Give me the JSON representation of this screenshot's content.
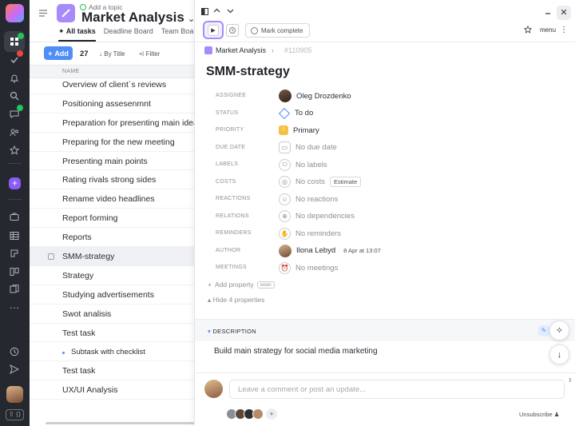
{
  "sidebar": {
    "icons": [
      "home-icon",
      "check-icon",
      "bell-icon",
      "search-icon",
      "chat-icon",
      "people-icon",
      "star-icon",
      "plus-icon",
      "briefcase-icon",
      "table-icon",
      "board-icon",
      "kanban-icon",
      "files-icon",
      "more-icon",
      "clock-icon",
      "send-icon"
    ],
    "shortcut_label": "⇧ ⟨⟩"
  },
  "project": {
    "topic_label": "Add a topic",
    "title": "Market Analysis",
    "tabs": [
      {
        "label": "All tasks",
        "active": true
      },
      {
        "label": "Deadline Board",
        "active": false
      },
      {
        "label": "Team Board",
        "active": false
      }
    ],
    "add_label": "Add",
    "count": "27",
    "sort_label": "By Title",
    "filter_label": "Filter",
    "column_header": "NAME"
  },
  "tasks": [
    {
      "title": "Overview of client`s reviews"
    },
    {
      "title": "Positioning assesenmnt"
    },
    {
      "title": "Preparation for presenting main ideas"
    },
    {
      "title": "Preparing for the new meeting"
    },
    {
      "title": "Presenting main points"
    },
    {
      "title": "Rating rivals strong sides"
    },
    {
      "title": "Rename video headlines"
    },
    {
      "title": "Report forming"
    },
    {
      "title": "Reports"
    },
    {
      "title": "SMM-strategy",
      "selected": true
    },
    {
      "title": "Strategy"
    },
    {
      "title": "Studying advertisements"
    },
    {
      "title": "Swot analisis"
    },
    {
      "title": "Test task"
    },
    {
      "title": "Subtask with checklist",
      "subtask": true
    },
    {
      "title": "Test task"
    },
    {
      "title": "UX/UI Analysis"
    }
  ],
  "detail": {
    "mark_complete": "Mark complete",
    "menu_label": "menu",
    "breadcrumb_project": "Market Analysis",
    "breadcrumb_id": "#110905",
    "task_title": "SMM-strategy",
    "properties": [
      {
        "key": "ASSIGNEE",
        "value": "Oleg Drozdenko",
        "icon": "avatar"
      },
      {
        "key": "STATUS",
        "value": "To do",
        "icon": "status-diamond-icon"
      },
      {
        "key": "PRIORITY",
        "value": "Primary",
        "icon": "priority-flag-icon"
      },
      {
        "key": "DUE DATE",
        "value": "No due date",
        "icon": "calendar-icon"
      },
      {
        "key": "LABELS",
        "value": "No labels",
        "icon": "tag-icon"
      },
      {
        "key": "COSTS",
        "value": "No costs",
        "icon": "coin-icon",
        "extra": "Estimate"
      },
      {
        "key": "REACTIONS",
        "value": "No reactions",
        "icon": "smile-icon"
      },
      {
        "key": "RELATIONS",
        "value": "No dependencies",
        "icon": "link-icon"
      },
      {
        "key": "REMINDERS",
        "value": "No reminders",
        "icon": "hand-icon"
      },
      {
        "key": "AUTHOR",
        "value": "Ilona Lebyd",
        "icon": "avatar",
        "extra": "8 Apr at 13:07"
      },
      {
        "key": "MEETINGS",
        "value": "No meetings",
        "icon": "alarm-icon"
      }
    ],
    "add_property": "Add property",
    "soon_badge": "soon",
    "hide_properties": "Hide 4 properties",
    "description_label": "DESCRIPTION",
    "description_text": "Build main strategy for social media marketing",
    "comment_placeholder": "Leave a comment or post an update...",
    "unsubscribe_label": "Unsubscribe"
  },
  "colors": {
    "accent": "#4f8ef7",
    "project": "#a78bfa",
    "rail": "#25282e",
    "priority": "#f6c142"
  }
}
